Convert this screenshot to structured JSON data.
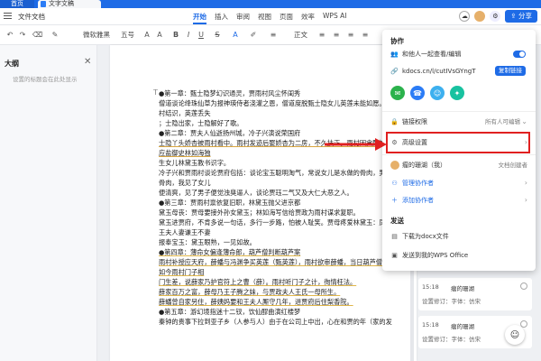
{
  "titlebar": {
    "home": "首页",
    "doc_tab": "文字文稿"
  },
  "menubar": {
    "file_menu": "文件文档",
    "tabs": [
      "开始",
      "插入",
      "审阅",
      "视图",
      "页面",
      "效率",
      "WPS AI"
    ],
    "active_tab": "开始",
    "share": "分享"
  },
  "toolbar": {
    "font_name": "微软雅黑",
    "font_size": "五号",
    "paragraph": "正文"
  },
  "outline": {
    "title": "大纲",
    "hint": "设置的标题会在此处显示"
  },
  "doc": {
    "lines": [
      "●第一章：甄士隐梦幻识通灵，贾雨村风尘怀闺秀",
      "僧道谈论绛珠仙草为报神瑛侍者浇灌之恩，僧道度脱甄士隐女儿英莲未能如愿。甄士隐结",
      "村结识，英莲丢失",
      "；士隐出家，士隐解好了歌。",
      "●第二章：贾夫人仙逝扬州城，冷子兴演说荣国府",
      "士隐丫头娇杏被雨村看中。雨村发迹后娶娇杏为二房，不久扶正。雨村因贪酷被革职，游",
      "应盐御史林如海独",
      "生女儿林黛玉教书识字。",
      "冷子兴和贾雨村谈论贾府包括：谈论宝玉聪明淘气，常说女儿是水做的骨肉，男人是泥做的",
      "骨肉，我见了女儿",
      "便清爽，见了男子便觉浊臭逼人，谈论贾珏二气又及大仁大恶之人。",
      "●第三章：贾雨村禀依复旧职，林黛玉抛父进京都",
      "黛玉母丧：贾母要接外孙女黛玉；林如海写信给贾政为雨村谋求复职。",
      "黛玉进贾府，不肯多说一句话，多行一步路，怕被人耻笑。贾母疼爱林黛玉：凤辣子",
      "王夫人妻谦王不妻",
      "报奉宝玉：黛玉眼熟，一见如故。",
      "●第四章：薄命女偏逢薄命郎，葫芦僧判断葫芦案",
      "雨村补授应天府，薛蟠与冯渊争买英莲（甄英莲），雨村欲审薛蟠，当日葫芦僧小沙弥，",
      "如今雨村门子相",
      "门生差，说薛家乃护官符上之曹（薛）。雨村听门子之计，徇情枉法。",
      "薛家百万之富，薛母乃王子腾之妹，与贾政夫人王氏一母所生。",
      "薛蟠曾自家另住，薛姨妈要和王夫人厮守几年，进贾府后住梨香院。",
      "●第五章：游幻境指迷十二钗，饮仙醪曲演红楼梦",
      "秦钟的贵事下拉到亚子乡（人参与人）由于在公司上中出，心在和贾的年（家的发"
    ]
  },
  "panel": {
    "section_collab": "协作",
    "collab_toggle": "和他人一起查看/编辑",
    "link": "kdocs.cn/l/cutIVsGYngT",
    "copy_link": "复制链接",
    "link_perm": "链接权限",
    "link_perm_value": "所有人可编辑",
    "advanced": "高级设置",
    "owner_name": "瘤的珊湖（我）",
    "owner_role": "文档创建者",
    "manage": "管理协作者",
    "add": "添加协作者",
    "section_send": "发送",
    "download": "下载为docx文件",
    "send_wps": "发送到我的WPS Office"
  },
  "comments": [
    {
      "time": "15:18",
      "author": "瘤的珊湖",
      "body": "设置修订：字体：仿宋"
    },
    {
      "time": "15:18",
      "author": "瘤的珊湖",
      "body": "设置修订：字体：仿宋"
    }
  ],
  "colors": {
    "accent": "#1e6be6",
    "highlight": "#e02020"
  }
}
